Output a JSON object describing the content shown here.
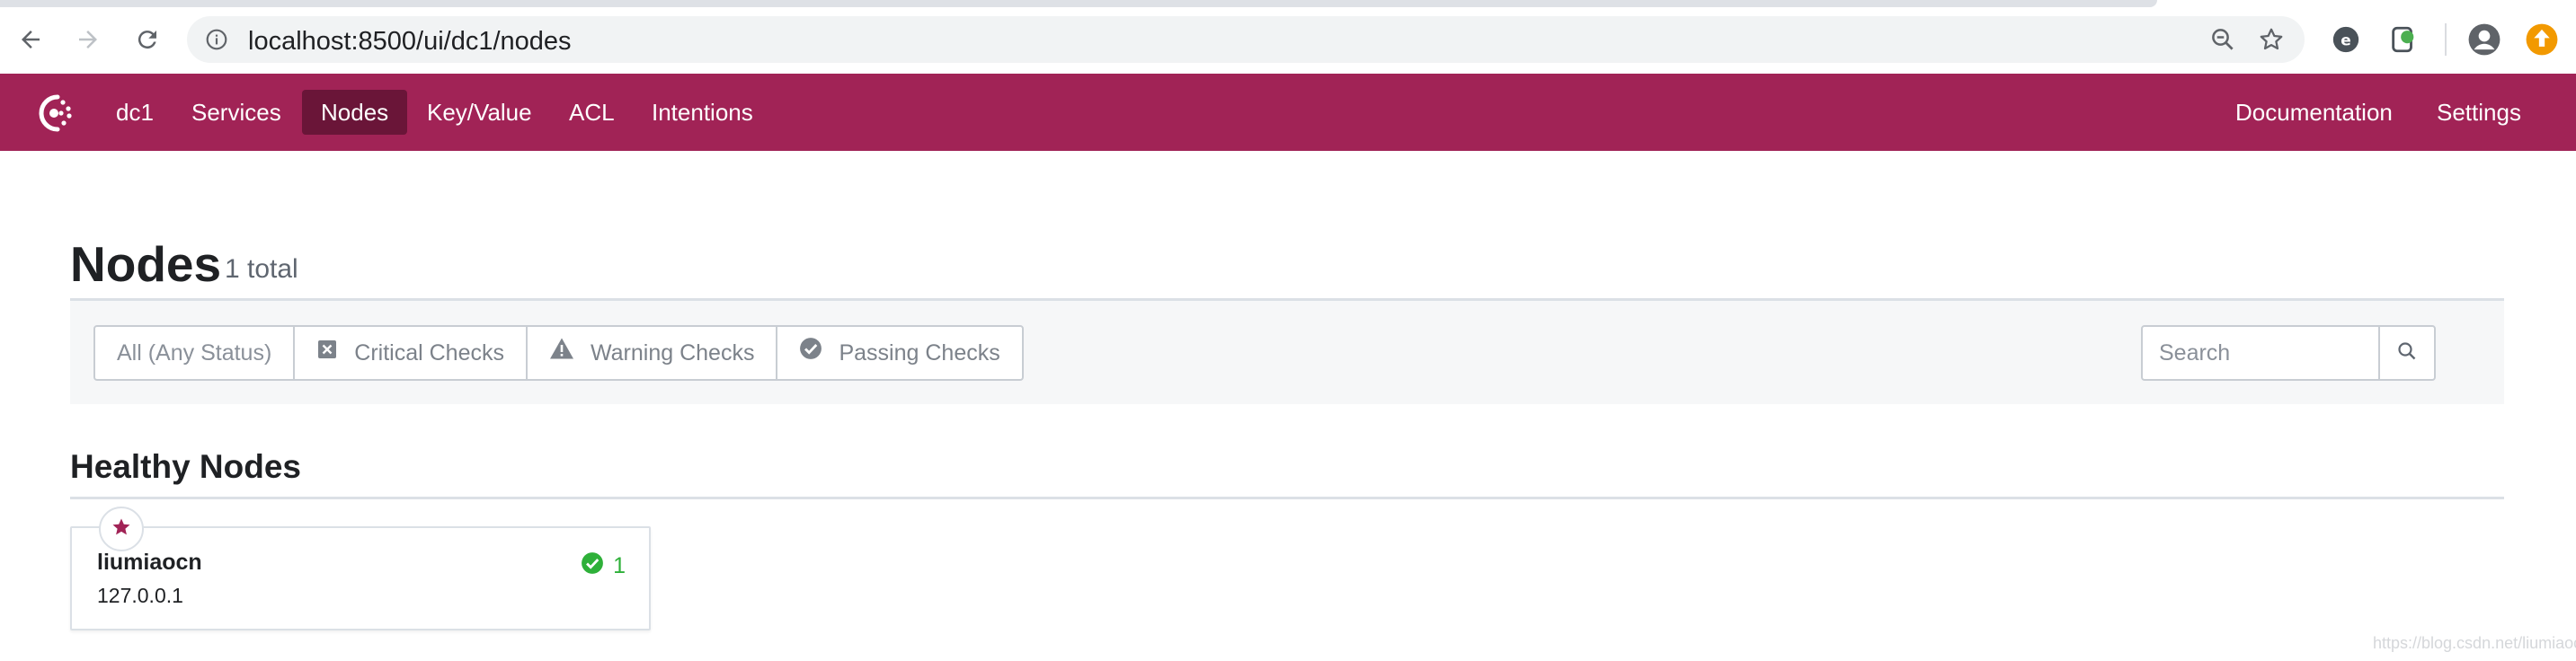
{
  "browser": {
    "url": "localhost:8500/ui/dc1/nodes",
    "icons": [
      "back-icon",
      "forward-icon",
      "reload-icon",
      "info-icon",
      "zoom-icon",
      "bookmark-star-icon",
      "extension-icon",
      "extension-icon",
      "profile-icon",
      "update-icon"
    ]
  },
  "nav": {
    "datacenter": "dc1",
    "items": [
      "Services",
      "Nodes",
      "Key/Value",
      "ACL",
      "Intentions"
    ],
    "active": "Nodes",
    "right": [
      "Documentation",
      "Settings"
    ],
    "brand_color": "#a12356",
    "active_color": "#6a1538"
  },
  "page": {
    "title": "Nodes",
    "count": "1 total"
  },
  "filters": {
    "options": [
      "All (Any Status)",
      "Critical Checks",
      "Warning Checks",
      "Passing Checks"
    ],
    "selected": "All (Any Status)",
    "search_placeholder": "Search"
  },
  "section": {
    "title": "Healthy Nodes"
  },
  "nodes": [
    {
      "name": "liumiaocn",
      "address": "127.0.0.1",
      "passing_count": "1",
      "leader": true
    }
  ],
  "watermark": "https://blog.csdn.net/liumiaocn",
  "colors": {
    "passing": "#2eb039",
    "leader_star": "#a12356"
  }
}
